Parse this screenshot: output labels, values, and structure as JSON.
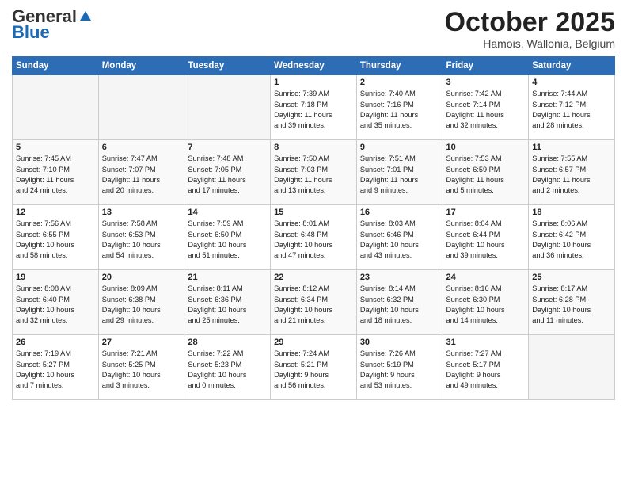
{
  "header": {
    "logo_general": "General",
    "logo_blue": "Blue",
    "month_title": "October 2025",
    "location": "Hamois, Wallonia, Belgium"
  },
  "weekdays": [
    "Sunday",
    "Monday",
    "Tuesday",
    "Wednesday",
    "Thursday",
    "Friday",
    "Saturday"
  ],
  "weeks": [
    [
      {
        "day": "",
        "info": "",
        "empty": true
      },
      {
        "day": "",
        "info": "",
        "empty": true
      },
      {
        "day": "",
        "info": "",
        "empty": true
      },
      {
        "day": "1",
        "info": "Sunrise: 7:39 AM\nSunset: 7:18 PM\nDaylight: 11 hours\nand 39 minutes."
      },
      {
        "day": "2",
        "info": "Sunrise: 7:40 AM\nSunset: 7:16 PM\nDaylight: 11 hours\nand 35 minutes."
      },
      {
        "day": "3",
        "info": "Sunrise: 7:42 AM\nSunset: 7:14 PM\nDaylight: 11 hours\nand 32 minutes."
      },
      {
        "day": "4",
        "info": "Sunrise: 7:44 AM\nSunset: 7:12 PM\nDaylight: 11 hours\nand 28 minutes."
      }
    ],
    [
      {
        "day": "5",
        "info": "Sunrise: 7:45 AM\nSunset: 7:10 PM\nDaylight: 11 hours\nand 24 minutes."
      },
      {
        "day": "6",
        "info": "Sunrise: 7:47 AM\nSunset: 7:07 PM\nDaylight: 11 hours\nand 20 minutes."
      },
      {
        "day": "7",
        "info": "Sunrise: 7:48 AM\nSunset: 7:05 PM\nDaylight: 11 hours\nand 17 minutes."
      },
      {
        "day": "8",
        "info": "Sunrise: 7:50 AM\nSunset: 7:03 PM\nDaylight: 11 hours\nand 13 minutes."
      },
      {
        "day": "9",
        "info": "Sunrise: 7:51 AM\nSunset: 7:01 PM\nDaylight: 11 hours\nand 9 minutes."
      },
      {
        "day": "10",
        "info": "Sunrise: 7:53 AM\nSunset: 6:59 PM\nDaylight: 11 hours\nand 5 minutes."
      },
      {
        "day": "11",
        "info": "Sunrise: 7:55 AM\nSunset: 6:57 PM\nDaylight: 11 hours\nand 2 minutes."
      }
    ],
    [
      {
        "day": "12",
        "info": "Sunrise: 7:56 AM\nSunset: 6:55 PM\nDaylight: 10 hours\nand 58 minutes."
      },
      {
        "day": "13",
        "info": "Sunrise: 7:58 AM\nSunset: 6:53 PM\nDaylight: 10 hours\nand 54 minutes."
      },
      {
        "day": "14",
        "info": "Sunrise: 7:59 AM\nSunset: 6:50 PM\nDaylight: 10 hours\nand 51 minutes."
      },
      {
        "day": "15",
        "info": "Sunrise: 8:01 AM\nSunset: 6:48 PM\nDaylight: 10 hours\nand 47 minutes."
      },
      {
        "day": "16",
        "info": "Sunrise: 8:03 AM\nSunset: 6:46 PM\nDaylight: 10 hours\nand 43 minutes."
      },
      {
        "day": "17",
        "info": "Sunrise: 8:04 AM\nSunset: 6:44 PM\nDaylight: 10 hours\nand 39 minutes."
      },
      {
        "day": "18",
        "info": "Sunrise: 8:06 AM\nSunset: 6:42 PM\nDaylight: 10 hours\nand 36 minutes."
      }
    ],
    [
      {
        "day": "19",
        "info": "Sunrise: 8:08 AM\nSunset: 6:40 PM\nDaylight: 10 hours\nand 32 minutes."
      },
      {
        "day": "20",
        "info": "Sunrise: 8:09 AM\nSunset: 6:38 PM\nDaylight: 10 hours\nand 29 minutes."
      },
      {
        "day": "21",
        "info": "Sunrise: 8:11 AM\nSunset: 6:36 PM\nDaylight: 10 hours\nand 25 minutes."
      },
      {
        "day": "22",
        "info": "Sunrise: 8:12 AM\nSunset: 6:34 PM\nDaylight: 10 hours\nand 21 minutes."
      },
      {
        "day": "23",
        "info": "Sunrise: 8:14 AM\nSunset: 6:32 PM\nDaylight: 10 hours\nand 18 minutes."
      },
      {
        "day": "24",
        "info": "Sunrise: 8:16 AM\nSunset: 6:30 PM\nDaylight: 10 hours\nand 14 minutes."
      },
      {
        "day": "25",
        "info": "Sunrise: 8:17 AM\nSunset: 6:28 PM\nDaylight: 10 hours\nand 11 minutes."
      }
    ],
    [
      {
        "day": "26",
        "info": "Sunrise: 7:19 AM\nSunset: 5:27 PM\nDaylight: 10 hours\nand 7 minutes."
      },
      {
        "day": "27",
        "info": "Sunrise: 7:21 AM\nSunset: 5:25 PM\nDaylight: 10 hours\nand 3 minutes."
      },
      {
        "day": "28",
        "info": "Sunrise: 7:22 AM\nSunset: 5:23 PM\nDaylight: 10 hours\nand 0 minutes."
      },
      {
        "day": "29",
        "info": "Sunrise: 7:24 AM\nSunset: 5:21 PM\nDaylight: 9 hours\nand 56 minutes."
      },
      {
        "day": "30",
        "info": "Sunrise: 7:26 AM\nSunset: 5:19 PM\nDaylight: 9 hours\nand 53 minutes."
      },
      {
        "day": "31",
        "info": "Sunrise: 7:27 AM\nSunset: 5:17 PM\nDaylight: 9 hours\nand 49 minutes."
      },
      {
        "day": "",
        "info": "",
        "empty": true
      }
    ]
  ]
}
